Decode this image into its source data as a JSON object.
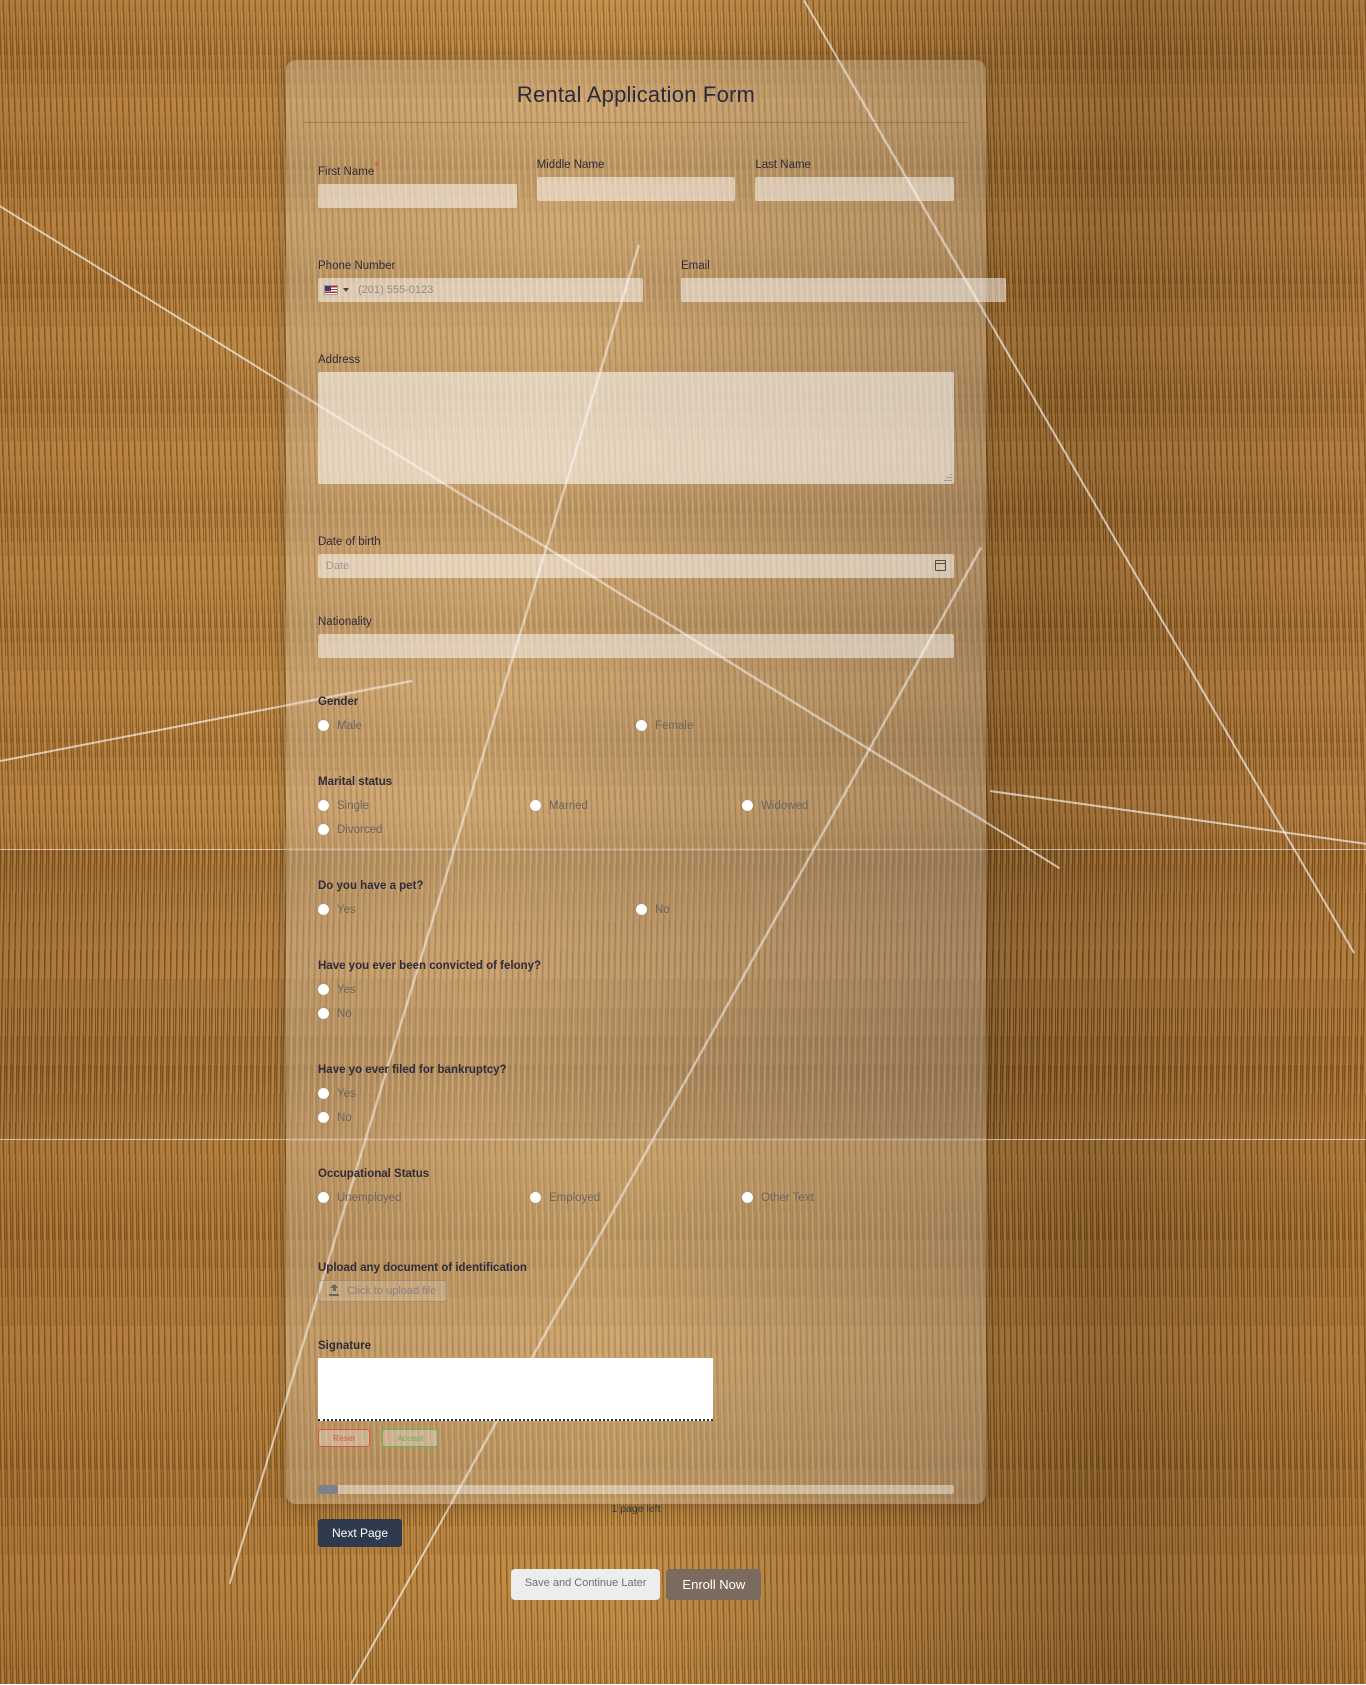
{
  "form": {
    "title": "Rental Application Form",
    "fields": {
      "first_name": {
        "label": "First Name",
        "required_marker": "*",
        "value": ""
      },
      "middle_name": {
        "label": "Middle Name",
        "value": ""
      },
      "last_name": {
        "label": "Last Name",
        "value": ""
      },
      "phone": {
        "label": "Phone Number",
        "placeholder": "(201) 555-0123",
        "country": "US",
        "value": ""
      },
      "email": {
        "label": "Email",
        "value": ""
      },
      "address": {
        "label": "Address",
        "value": ""
      },
      "dob": {
        "label": "Date of birth",
        "placeholder": "Date",
        "value": ""
      },
      "nationality": {
        "label": "Nationality",
        "value": ""
      }
    },
    "gender": {
      "label": "Gender",
      "options": [
        "Male",
        "Female"
      ]
    },
    "marital_status": {
      "label": "Marital status",
      "options": [
        "Single",
        "Married",
        "Widowed",
        "Divorced"
      ]
    },
    "pet": {
      "label": "Do you have a pet?",
      "options": [
        "Yes",
        "No"
      ]
    },
    "felony": {
      "label": "Have you ever been convicted of felony?",
      "options": [
        "Yes",
        "No"
      ]
    },
    "bankruptcy": {
      "label": "Have yo ever filed for bankruptcy?",
      "options": [
        "Yes",
        "No"
      ]
    },
    "occupational_status": {
      "label": "Occupational Status",
      "options": [
        "Unemployed",
        "Employed",
        "Other Text"
      ]
    },
    "upload": {
      "label": "Upload any document of identification",
      "button_label": "Click to upload file"
    },
    "signature": {
      "label": "Signature",
      "reset_label": "Reset",
      "accept_label": "Accept"
    },
    "progress": {
      "pages_left": "1 page left",
      "percent": 3
    },
    "buttons": {
      "next_page": "Next Page",
      "save_later": "Save and Continue Later",
      "enroll": "Enroll Now"
    }
  },
  "colors": {
    "accent_dark": "#2f3a4f",
    "enroll": "#7a6b5e",
    "required": "#e0452f",
    "reset": "#d9534f",
    "accept": "#5cb85c"
  }
}
